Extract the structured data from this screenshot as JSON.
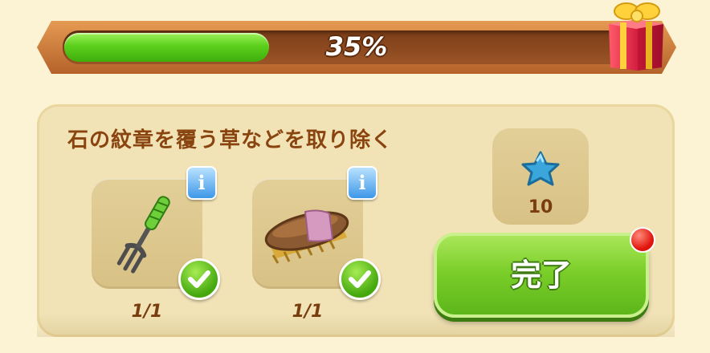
{
  "progress": {
    "percent_label": "35%",
    "fraction": 0.35
  },
  "task": {
    "title": "石の紋章を覆う草などを取り除く",
    "items": [
      {
        "icon": "garden-fork-icon",
        "count": "1/1",
        "done": true
      },
      {
        "icon": "scrub-brush-icon",
        "count": "1/1",
        "done": true
      }
    ]
  },
  "reward": {
    "icon": "blue-star-icon",
    "count": "10"
  },
  "actions": {
    "complete_label": "完了"
  },
  "colors": {
    "accent_green": "#5ab419",
    "frame_orange": "#c87434",
    "text_brown": "#8a4410"
  }
}
